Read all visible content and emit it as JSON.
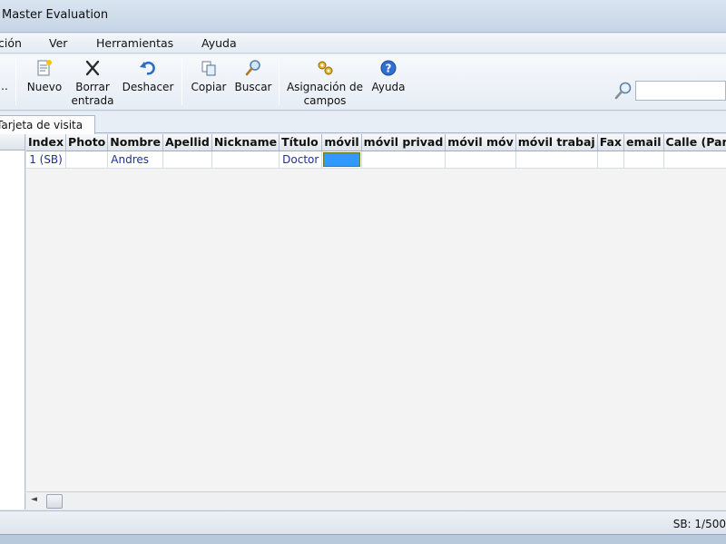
{
  "window": {
    "title": "Master Evaluation"
  },
  "menu": {
    "items": [
      "ción",
      "Ver",
      "Herramientas",
      "Ayuda"
    ]
  },
  "toolbar": {
    "overflow": "..",
    "nuevo": "Nuevo",
    "borrar_l1": "Borrar",
    "borrar_l2": "entrada",
    "deshacer": "Deshacer",
    "copiar": "Copiar",
    "buscar": "Buscar",
    "asignacion_l1": "Asignación de",
    "asignacion_l2": "campos",
    "ayuda": "Ayuda"
  },
  "search": {
    "value": "",
    "placeholder": ""
  },
  "tabs": [
    {
      "label": "Tarjeta de visita"
    }
  ],
  "grid": {
    "columns": [
      "Index",
      "Photo",
      "Nombre",
      "Apellid",
      "Nickname",
      "Título",
      "móvil",
      "móvil privad",
      "móvil móv",
      "móvil trabaj",
      "Fax",
      "email",
      "Calle (Par"
    ],
    "rows": [
      [
        "1 (SB)",
        "",
        "Andres",
        "",
        "",
        "Doctor",
        "",
        "",
        "",
        "",
        "",
        "",
        ""
      ]
    ]
  },
  "status": {
    "text": "SB: 1/500"
  },
  "colors": {
    "selection": "#3399ff",
    "cell_text": "#1e2e9a"
  }
}
